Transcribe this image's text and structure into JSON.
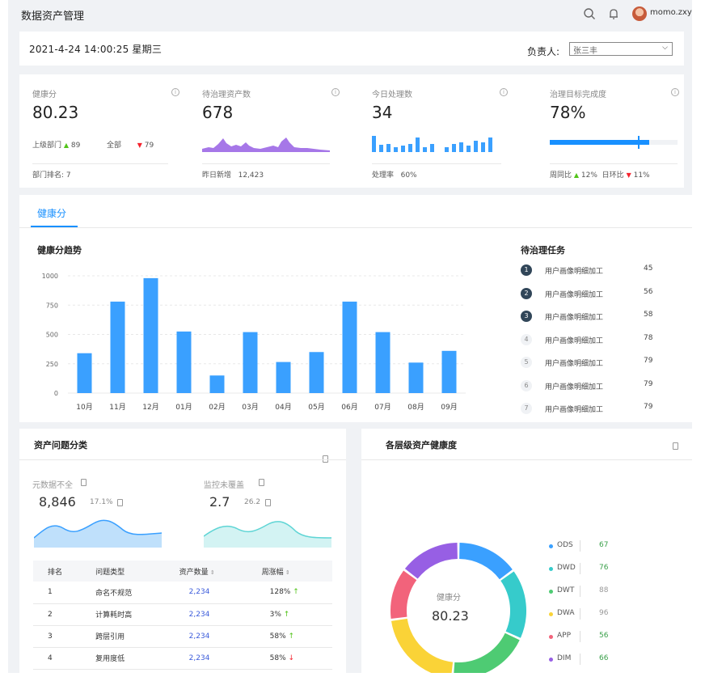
{
  "app": {
    "title": "数据资产管理",
    "username": "momo.zxy"
  },
  "datebar": {
    "datetime": "2021-4-24  14:00:25   星期三",
    "owner_label": "负责人:",
    "owner_value": "张三丰"
  },
  "stats": {
    "health": {
      "label": "健康分",
      "value": "80.23",
      "upper_label": "上级部门",
      "upper_value": "89",
      "all_label": "全部",
      "all_value": "79",
      "footer_label": "部门排名:",
      "footer_value": "7"
    },
    "pending": {
      "label": "待治理资产数",
      "value": "678",
      "footer_label": "昨日新增",
      "footer_value": "12,423"
    },
    "today": {
      "label": "今日处理数",
      "value": "34",
      "footer_label": "处理率",
      "footer_value": "60%"
    },
    "goal": {
      "label": "治理目标完成度",
      "value": "78%",
      "progress": 0.78,
      "wow_label": "周同比",
      "wow_value": "12%",
      "dod_label": "日环比",
      "dod_value": "11%"
    }
  },
  "health_section": {
    "tab_label": "健康分",
    "trend_title": "健康分趋势",
    "tasks_title": "待治理任务"
  },
  "chart_data": {
    "type": "bar",
    "categories": [
      "10月",
      "11月",
      "12月",
      "01月",
      "02月",
      "03月",
      "04月",
      "05月",
      "06月",
      "07月",
      "08月",
      "09月"
    ],
    "values": [
      340,
      780,
      980,
      525,
      150,
      520,
      265,
      350,
      780,
      520,
      260,
      360
    ],
    "ylim": [
      0,
      1000
    ],
    "yticks": [
      "0",
      "250",
      "500",
      "750",
      "1000"
    ],
    "color": "#3aa0ff",
    "grid": true
  },
  "tasks": [
    {
      "rank": "1",
      "name": "用户画像明细加工",
      "value": "45",
      "style": "dark"
    },
    {
      "rank": "2",
      "name": "用户画像明细加工",
      "value": "56",
      "style": "dark"
    },
    {
      "rank": "3",
      "name": "用户画像明细加工",
      "value": "58",
      "style": "dark"
    },
    {
      "rank": "4",
      "name": "用户画像明细加工",
      "value": "78",
      "style": "light"
    },
    {
      "rank": "5",
      "name": "用户画像明细加工",
      "value": "79",
      "style": "light"
    },
    {
      "rank": "6",
      "name": "用户画像明细加工",
      "value": "79",
      "style": "light"
    },
    {
      "rank": "7",
      "name": "用户画像明细加工",
      "value": "79",
      "style": "light"
    }
  ],
  "issues": {
    "title": "资产问题分类",
    "metric1": {
      "label": "元数据不全",
      "value": "8,846",
      "pct": "17.1%"
    },
    "metric2": {
      "label": "监控未覆盖",
      "value": "2.7",
      "pct": "26.2"
    },
    "table": {
      "headers": [
        "排名",
        "问题类型",
        "资产数量",
        "周涨幅"
      ],
      "rows": [
        {
          "rank": "1",
          "type": "命名不规范",
          "count": "2,234",
          "change": "128%",
          "trend": "up"
        },
        {
          "rank": "2",
          "type": "计算耗时高",
          "count": "2,234",
          "change": "3%",
          "trend": "up"
        },
        {
          "rank": "3",
          "type": "跨层引用",
          "count": "2,234",
          "change": "58%",
          "trend": "up"
        },
        {
          "rank": "4",
          "type": "复用度低",
          "count": "2,234",
          "change": "58%",
          "trend": "down"
        }
      ]
    }
  },
  "levels": {
    "title": "各层级资产健康度",
    "center_label": "健康分",
    "center_value": "80.23",
    "items": [
      {
        "name": "ODS",
        "value": "67",
        "color": "#3aa0ff",
        "value_color": "#3aa04a"
      },
      {
        "name": "DWD",
        "value": "76",
        "color": "#36cbcb",
        "value_color": "#3aa04a"
      },
      {
        "name": "DWT",
        "value": "88",
        "color": "#4ecb73",
        "value_color": "#999999"
      },
      {
        "name": "DWA",
        "value": "96",
        "color": "#fad337",
        "value_color": "#999999"
      },
      {
        "name": "APP",
        "value": "56",
        "color": "#f2637b",
        "value_color": "#3aa04a"
      },
      {
        "name": "DIM",
        "value": "66",
        "color": "#975fe4",
        "value_color": "#3aa04a"
      }
    ]
  }
}
